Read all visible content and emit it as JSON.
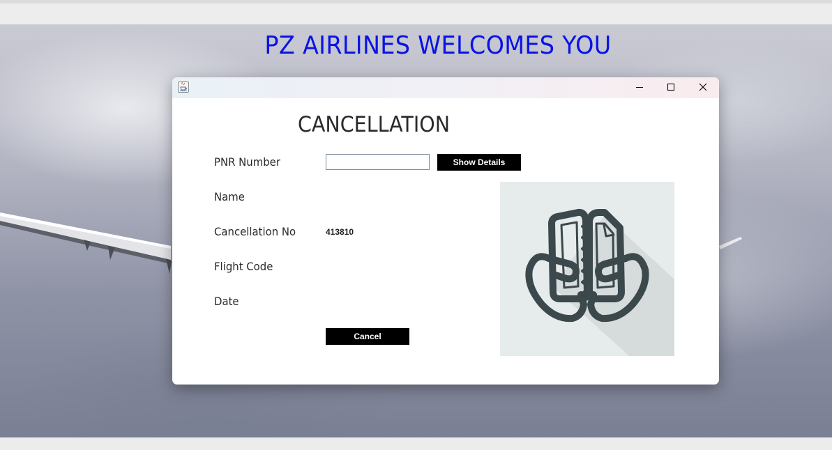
{
  "page": {
    "heading": "PZ AIRLINES WELCOMES YOU"
  },
  "dialog": {
    "heading": "CANCELLATION",
    "labels": {
      "pnr": "PNR Number",
      "name": "Name",
      "cancellation_no": "Cancellation No",
      "flight_code": "Flight Code",
      "date": "Date"
    },
    "values": {
      "pnr": "",
      "name": "",
      "cancellation_no": "413810",
      "flight_code": "",
      "date": ""
    },
    "buttons": {
      "show_details": "Show Details",
      "cancel": "Cancel"
    },
    "window_controls": [
      "minimize-icon",
      "maximize-icon",
      "close-icon"
    ],
    "illustration_icon": "torn-ticket-icon"
  },
  "colors": {
    "heading_blue": "#0a13e6",
    "button_bg": "#000000",
    "button_text": "#ffffff",
    "illustration_bg": "#e6ebeb",
    "icon_stroke": "#3b484c"
  }
}
